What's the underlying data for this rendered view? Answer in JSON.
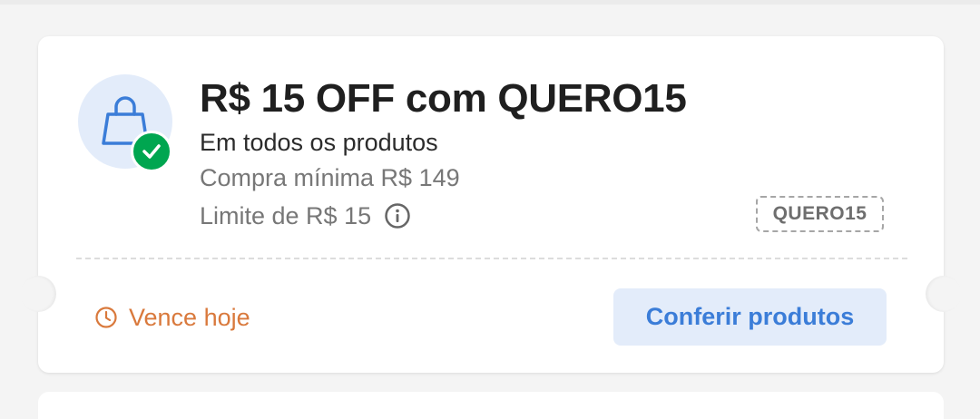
{
  "coupon": {
    "title": "R$ 15 OFF com QUERO15",
    "subtitle": "Em todos os produtos",
    "min_purchase": "Compra mínima R$ 149",
    "limit": "Limite de R$ 15",
    "code": "QUERO15",
    "expiry": "Vence hoje",
    "action_label": "Conferir produtos"
  },
  "icons": {
    "product": "shopping-bag-icon",
    "status": "check-icon",
    "info": "info-icon",
    "expiry": "clock-icon"
  },
  "colors": {
    "icon_bg": "#e3ecfa",
    "brand_blue": "#3b7dd8",
    "success_green": "#00a650",
    "expiry_orange": "#d9793c"
  }
}
